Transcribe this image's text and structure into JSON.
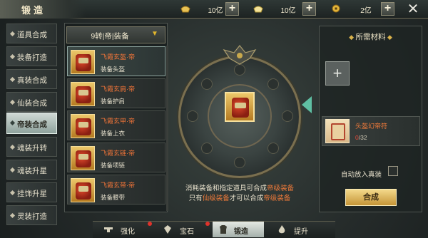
{
  "header": {
    "title": "锻造",
    "currencies": [
      {
        "icon": "gold-ingot-icon",
        "amount": "10亿"
      },
      {
        "icon": "silver-ingot-icon",
        "amount": "10亿"
      },
      {
        "icon": "coin-icon",
        "amount": "2亿"
      }
    ]
  },
  "left_tabs": [
    {
      "label": "道具合成",
      "active": false
    },
    {
      "label": "装备打造",
      "active": false
    },
    {
      "label": "真装合成",
      "active": false
    },
    {
      "label": "仙装合成",
      "active": false
    },
    {
      "label": "帝装合成",
      "active": true
    },
    {
      "label": "魂装升转",
      "active": false
    },
    {
      "label": "魂装升星",
      "active": false
    },
    {
      "label": "挂饰升星",
      "active": false
    },
    {
      "label": "灵装打造",
      "active": false
    }
  ],
  "filter": {
    "selected": "9转|帝|装备"
  },
  "items": [
    {
      "name": "飞霞玄盔·帝",
      "type": "装备头盔"
    },
    {
      "name": "飞霞玄肩·帝",
      "type": "装备护肩"
    },
    {
      "name": "飞霞玄甲·帝",
      "type": "装备上衣"
    },
    {
      "name": "飞霞玄链·帝",
      "type": "装备项链"
    },
    {
      "name": "飞霞玄带·帝",
      "type": "装备腰带"
    }
  ],
  "description": {
    "line1": [
      {
        "text": "消耗装备和指定道具可合成",
        "hl": false
      },
      {
        "text": "帝级装备",
        "hl": true
      }
    ],
    "line2": [
      {
        "text": "只有",
        "hl": false
      },
      {
        "text": "仙级装备",
        "hl": true
      },
      {
        "text": "才可以合成",
        "hl": false
      },
      {
        "text": "帝级装备",
        "hl": true
      }
    ]
  },
  "materials": {
    "title": "所需材料",
    "item_name": "头盔幻帝符",
    "count_have": "0",
    "count_need": "/32",
    "auto_add_label": "自动放入真装",
    "synth_button": "合成"
  },
  "bottom_tabs": [
    {
      "label": "强化",
      "icon": "anvil-icon",
      "active": false
    },
    {
      "label": "宝石",
      "icon": "gem-icon",
      "active": false
    },
    {
      "label": "锻造",
      "icon": "armor-icon",
      "active": true
    },
    {
      "label": "提升",
      "icon": "flame-icon",
      "active": false
    }
  ],
  "colors": {
    "accent_orange": "#f07438",
    "gold": "#d9b24b",
    "active_tab": "#cfd8d4"
  }
}
